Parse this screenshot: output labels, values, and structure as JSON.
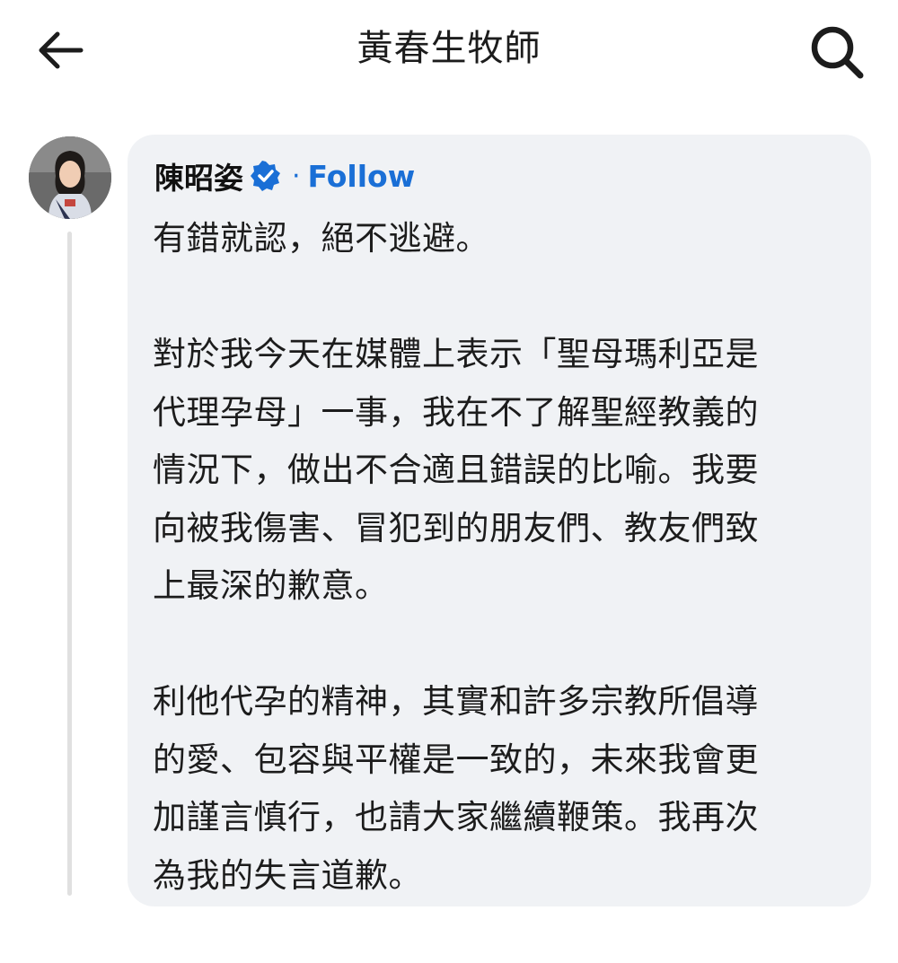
{
  "header": {
    "title": "黃春生牧師",
    "back_icon": "arrow-left-icon",
    "search_icon": "search-icon"
  },
  "comment": {
    "author": "陳昭姿",
    "verified_icon": "verified-badge-icon",
    "separator": "·",
    "follow_label": "Follow",
    "accent_color": "#1a6fd6",
    "paragraphs": [
      "有錯就認，絕不逃避。",
      "對於我今天在媒體上表示「聖母瑪利亞是\n代理孕母」一事，我在不了解聖經教義的\n情況下，做出不合適且錯誤的比喻。我要\n向被我傷害、冒犯到的朋友們、教友們致\n上最深的歉意。",
      "利他代孕的精神，其實和許多宗教所倡導\n的愛、包容與平權是一致的，未來我會更\n加謹言慎行，也請大家繼續鞭策。我再次\n為我的失言道歉。"
    ]
  }
}
